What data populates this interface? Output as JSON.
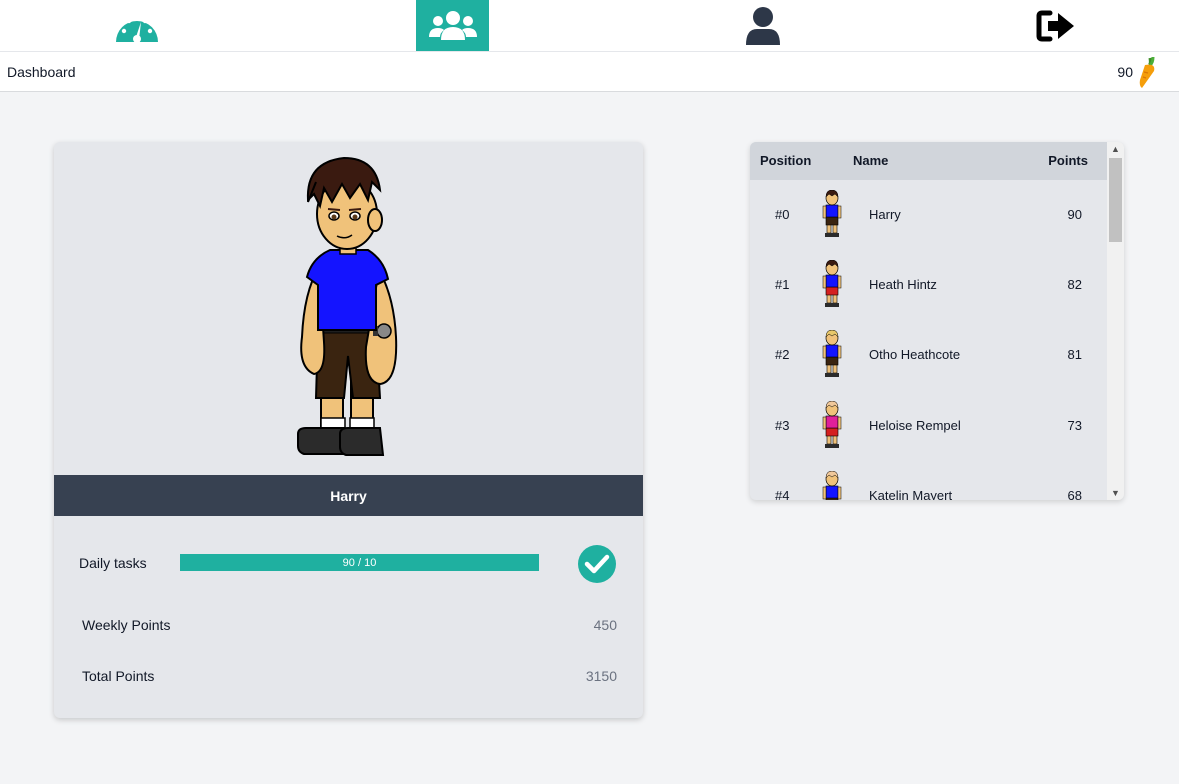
{
  "nav": {
    "items": [
      {
        "icon": "dashboard-gauge-icon"
      },
      {
        "icon": "group-icon",
        "active": true
      },
      {
        "icon": "user-icon"
      },
      {
        "icon": "logout-icon"
      }
    ],
    "accent": "#1fb0a0"
  },
  "header": {
    "title": "Dashboard",
    "carrots": "90",
    "carrot_icon": "carrot-icon"
  },
  "profile": {
    "name": "Harry",
    "daily_tasks_label": "Daily tasks",
    "daily_tasks_progress": "90 / 10",
    "daily_tasks_fraction": 1.0,
    "daily_tasks_status_icon": "check-circle-icon",
    "weekly_points_label": "Weekly Points",
    "weekly_points": "450",
    "total_points_label": "Total Points",
    "total_points": "3150"
  },
  "leaderboard": {
    "columns": {
      "position": "Position",
      "name": "Name",
      "points": "Points"
    },
    "rows": [
      {
        "position": "#0",
        "name": "Harry",
        "points": "90",
        "shirt": "#1414ff",
        "pants": "#3a2410",
        "hair": "#3a1a10"
      },
      {
        "position": "#1",
        "name": "Heath Hintz",
        "points": "82",
        "shirt": "#1414ff",
        "pants": "#d42020",
        "hair": "#3a1a10"
      },
      {
        "position": "#2",
        "name": "Otho Heathcote",
        "points": "81",
        "shirt": "#1414ff",
        "pants": "#3a2410",
        "hair": "#e8c86a"
      },
      {
        "position": "#3",
        "name": "Heloise Rempel",
        "points": "73",
        "shirt": "#e0209a",
        "pants": "#d42020",
        "hair": "#f0c89a"
      },
      {
        "position": "#4",
        "name": "Katelin Mayert",
        "points": "68",
        "shirt": "#1414ff",
        "pants": "#3a2410",
        "hair": "#f0c89a"
      }
    ]
  }
}
